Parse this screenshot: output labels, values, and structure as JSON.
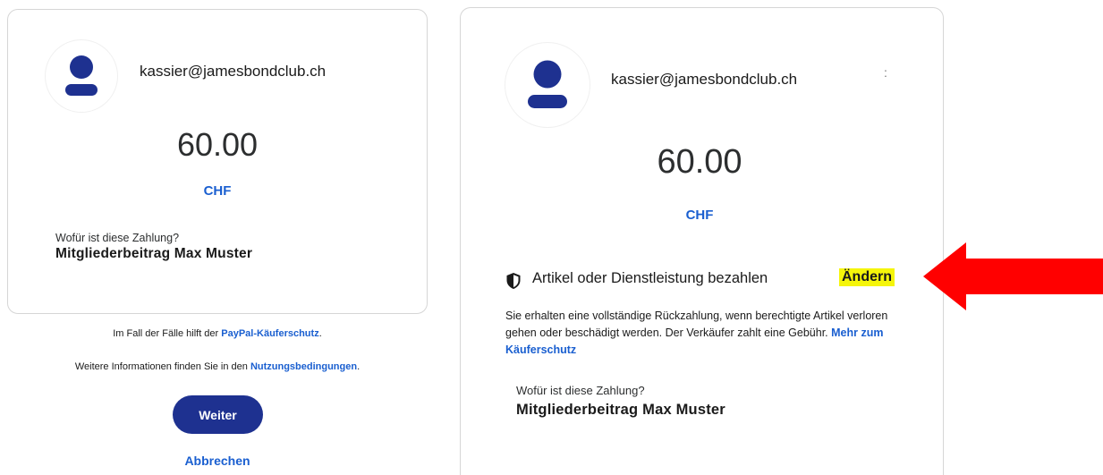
{
  "left": {
    "email": "kassier@jamesbondclub.ch",
    "amount": "60.00",
    "currency": "CHF",
    "question_label": "Wofür ist diese Zahlung?",
    "question_value": "Mitgliederbeitrag Max Muster",
    "protection_prefix": "Im Fall der Fälle hilft der ",
    "protection_link": "PayPal-Käuferschutz",
    "protection_suffix": ".",
    "terms_prefix": "Weitere Informationen finden Sie in den ",
    "terms_link": "Nutzungsbedingungen",
    "terms_suffix": ".",
    "continue_label": "Weiter",
    "cancel_label": "Abbrechen"
  },
  "right": {
    "email": "kassier@jamesbondclub.ch",
    "overflow_glyph": ":",
    "amount": "60.00",
    "currency": "CHF",
    "protection_title": "Artikel oder Dienstleistung bezahlen",
    "change_label": "Ändern",
    "protection_desc": "Sie erhalten eine vollständige Rückzahlung, wenn berechtigte Artikel verloren gehen oder beschädigt werden. Der Verkäufer zahlt eine Gebühr. ",
    "protection_more_link": "Mehr zum Käuferschutz",
    "question_label": "Wofür ist diese Zahlung?",
    "question_value": "Mitgliederbeitrag Max Muster"
  },
  "icons": {
    "avatar": "person-avatar-icon",
    "shield": "shield-icon",
    "arrow": "red-arrow-annotation"
  },
  "colors": {
    "brand_blue": "#1e3190",
    "link_blue": "#1a5fd0",
    "highlight": "#f5f50a",
    "arrow_red": "#ff0000"
  }
}
